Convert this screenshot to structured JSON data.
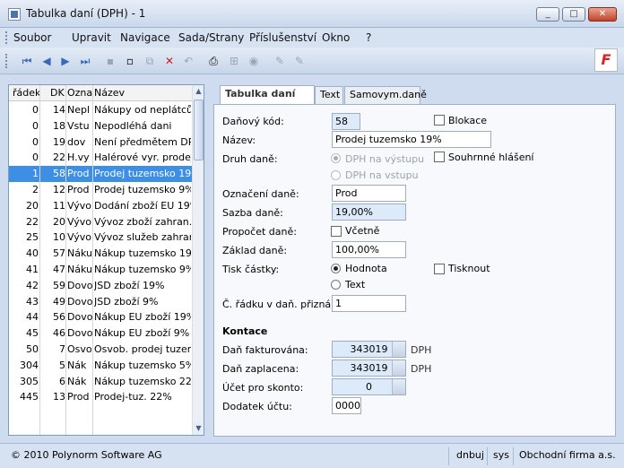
{
  "window": {
    "title": "Tabulka daní (DPH) - 1",
    "minimize": "_",
    "maximize": "□",
    "close": "✕"
  },
  "menu": [
    "Soubor",
    "Upravit",
    "Navigace",
    "Sada/Strany",
    "Příslušenství",
    "Okno",
    "?"
  ],
  "toolbar": {
    "icons": [
      "first-record-icon",
      "prev-record-icon",
      "next-record-icon",
      "last-record-icon",
      "save-icon",
      "new-icon",
      "copy-icon",
      "delete-icon",
      "undo-icon",
      "print-icon",
      "tree-icon",
      "disk-icon",
      "edit-icon",
      "edit-alt-icon"
    ],
    "glyphs": {
      "first": "⏮",
      "prev": "◀",
      "next": "▶",
      "last": "⏭",
      "save": "▪",
      "new": "▫",
      "copy": "⧉",
      "delete": "✕",
      "undo": "↶",
      "print": "⎙",
      "tree": "⊞",
      "disk": "◉",
      "edit": "✎",
      "edit2": "✎"
    },
    "logo": "F"
  },
  "list": {
    "headers": [
      "řádek",
      "DK",
      "Ozna",
      "Název"
    ],
    "rows": [
      [
        "0",
        "14",
        "Nepl",
        "Nákupy od neplátců"
      ],
      [
        "0",
        "18",
        "Vstu",
        "Nepodléhá dani"
      ],
      [
        "0",
        "19",
        "dov",
        "Není předmětem DPH"
      ],
      [
        "0",
        "22",
        "H.vy",
        "Halérové vyr. prodej"
      ],
      [
        "1",
        "58",
        "Prod",
        "Prodej tuzemsko 19%"
      ],
      [
        "2",
        "12",
        "Prod",
        "Prodej tuzemsko 9%"
      ],
      [
        "20",
        "11",
        "Vývo",
        "Dodání zboží EU 19%"
      ],
      [
        "22",
        "20",
        "Vývo",
        "Vývoz zboží zahran."
      ],
      [
        "25",
        "10",
        "Vývo",
        "Vývoz služeb zahran."
      ],
      [
        "40",
        "57",
        "Náku",
        "Nákup tuzemsko 19%"
      ],
      [
        "41",
        "47",
        "Náku",
        "Nákup tuzemsko 9%"
      ],
      [
        "42",
        "59",
        "Dovo",
        "JSD zboží 19%"
      ],
      [
        "43",
        "49",
        "Dovo",
        "JSD zboží 9%"
      ],
      [
        "44",
        "56",
        "Dovo",
        "Nákup EU zboží 19%"
      ],
      [
        "45",
        "46",
        "Dovo",
        "Nákup EU zboží 9%"
      ],
      [
        "50",
        "7",
        "Osvo",
        "Osvob. prodej tuzem."
      ],
      [
        "304",
        "5",
        "Nák",
        "Nákup tuzemsko 5%"
      ],
      [
        "305",
        "6",
        "Nák",
        "Nákup tuzemsko 22%"
      ],
      [
        "445",
        "13",
        "Prod",
        "Prodej-tuz. 22%"
      ]
    ],
    "selected_index": 4,
    "scroll_up": "▲",
    "scroll_down": "▼"
  },
  "tabs": [
    "Tabulka daní",
    "Text",
    "Samovym.daně"
  ],
  "form": {
    "dk_label": "Daňový kód:",
    "dk_value": "58",
    "blokace_label": "Blokace",
    "nazev_label": "Název:",
    "nazev_value": "Prodej tuzemsko 19%",
    "druh_label": "Druh daně:",
    "druh_opt1": "DPH na výstupu",
    "druh_opt2": "DPH na vstupu",
    "souhrnne_label": "Souhrnné hlášení",
    "oznaceni_label": "Označení daně:",
    "oznaceni_value": "Prod",
    "sazba_label": "Sazba daně:",
    "sazba_value": "19,00%",
    "propocet_label": "Propočet daně:",
    "vcetne_label": "Včetně",
    "zaklad_label": "Základ daně:",
    "zaklad_value": "100,00%",
    "tisk_label": "Tisk částky:",
    "tisk_opt1": "Hodnota",
    "tisk_opt2": "Text",
    "tisknout_label": "Tisknout",
    "radek_label": "Č. řádku v daň. přiznání:",
    "radek_value": "1",
    "kontace_label": "Kontace",
    "fakt_label": "Daň fakturována:",
    "fakt_value": "343019",
    "fakt_suffix": "DPH",
    "zapl_label": "Daň zaplacena:",
    "zapl_value": "343019",
    "zapl_suffix": "DPH",
    "skonto_label": "Účet pro skonto:",
    "skonto_value": "0",
    "dodatek_label": "Dodatek účtu:",
    "dodatek_value": "0000"
  },
  "status": {
    "copyright": "© 2010 Polynorm Software AG",
    "db": "dnbuj",
    "user": "sys",
    "company": "Obchodní firma a.s."
  }
}
